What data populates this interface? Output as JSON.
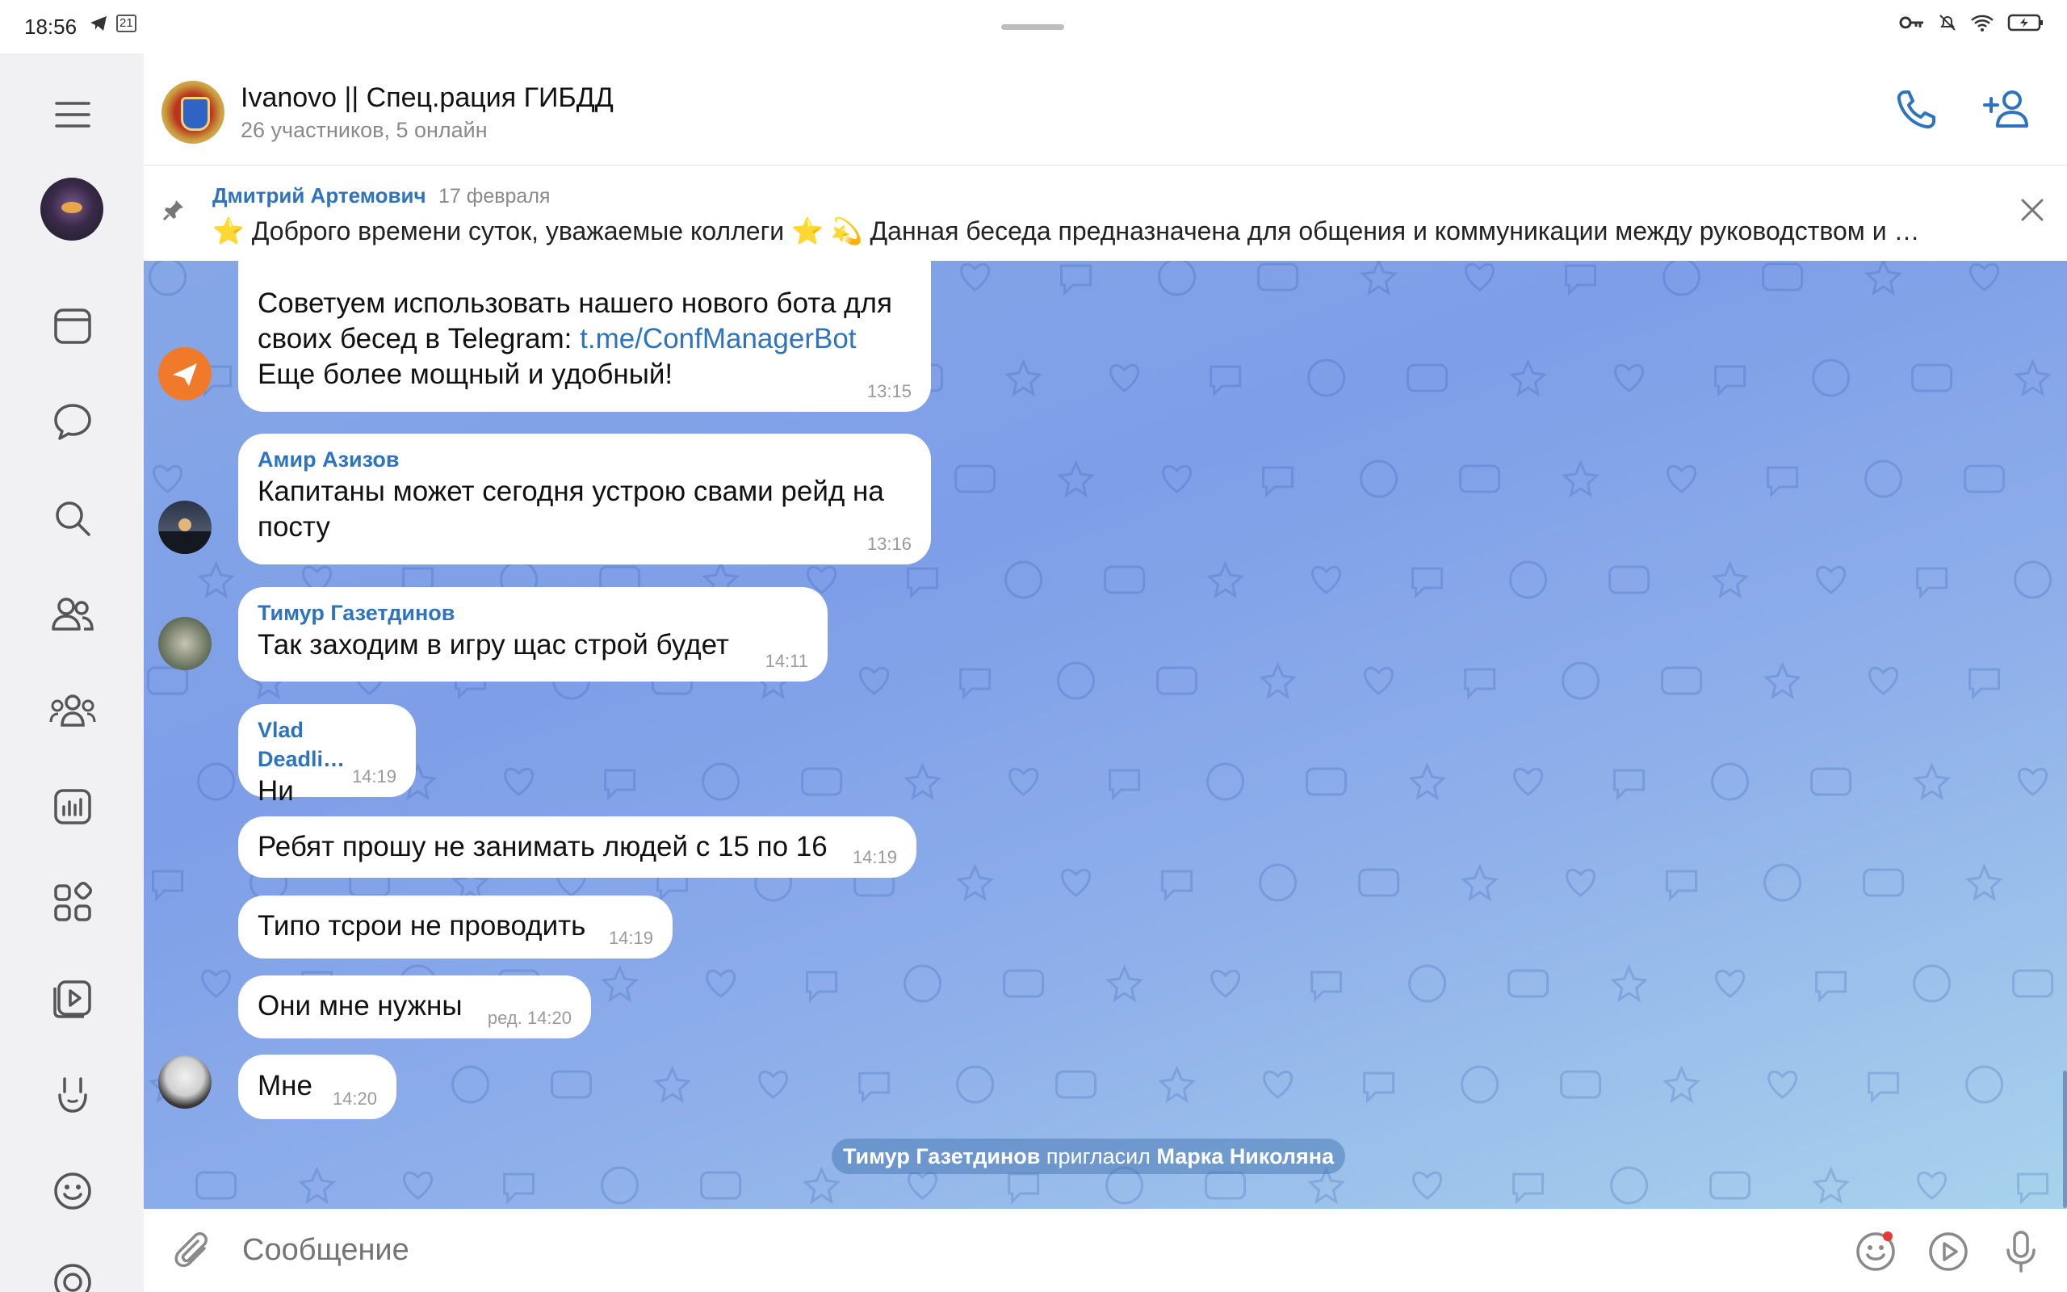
{
  "status": {
    "time": "18:56",
    "notif_count": "21"
  },
  "sidebar": {
    "items": [
      "menu-icon",
      "calendar-icon",
      "chat-icon",
      "search-icon",
      "contacts-icon",
      "groups-icon",
      "stats-icon",
      "apps-icon",
      "video-icon",
      "hand-icon",
      "emoji-icon",
      "stories-icon"
    ]
  },
  "header": {
    "title": "Ivanovo || Спец.рация ГИБДД",
    "subtitle": "26 участников, 5 онлайн"
  },
  "pinned": {
    "author": "Дмитрий Артемович",
    "date": "17 февраля",
    "text": "⭐️ Доброго времени суток, уважаемые коллеги ⭐️  💫 Данная беседа предназначена для общения и коммуникации между руководством и …"
  },
  "messages": [
    {
      "name": "",
      "text_before": "Советуем использовать нашего нового бота для своих бесед в Telegram: ",
      "link": "t.me/ConfManagerBot",
      "text_after": " Еще более мощный и удобный!",
      "time": "13:15"
    },
    {
      "name": "Амир Азизов",
      "text": "Капитаны может сегодня устрою свами рейд на посту",
      "time": "13:16"
    },
    {
      "name": "Тимур Газетдинов",
      "text": "Так заходим в игру щас строй будет",
      "time": "14:11"
    },
    {
      "name": "Vlad Deadli…",
      "text": "Ни",
      "time": "14:19"
    },
    {
      "name": "",
      "text": "Ребят прошу не занимать людей с 15 по 16",
      "time": "14:19"
    },
    {
      "name": "",
      "text": "Типо тсрои не проводить",
      "time": "14:19"
    },
    {
      "name": "",
      "text": "Они мне нужны",
      "time": "ред. 14:20"
    },
    {
      "name": "",
      "text": "Мне",
      "time": "14:20"
    }
  ],
  "service": {
    "actor": "Тимур Газетдинов",
    "action": " пригласил ",
    "target": "Марка Николяна"
  },
  "input": {
    "placeholder": "Сообщение"
  },
  "colors": {
    "accent": "#2d73c0",
    "bg_top": "#86a7e6",
    "bg_bottom": "#a8d3ec"
  }
}
